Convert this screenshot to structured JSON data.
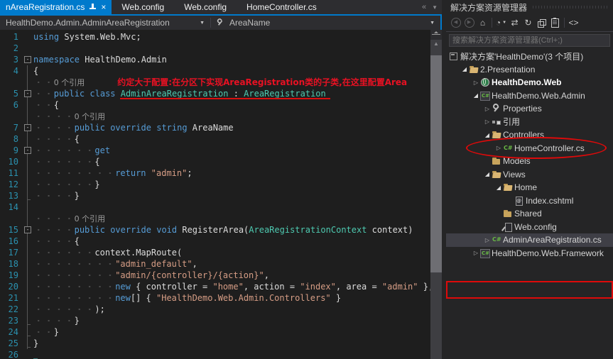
{
  "colors": {
    "accent": "#007ACC",
    "keyword": "#569CD6",
    "type": "#4EC9B0",
    "string": "#D69D85",
    "line_number": "#2B91AF",
    "annotation_red": "#DE0A0A",
    "editor_bg": "#1E1E1E",
    "panel_bg": "#252526"
  },
  "tabs": {
    "items": [
      {
        "label": "nAreaRegistration.cs",
        "active": true
      },
      {
        "label": "Web.config",
        "active": false
      },
      {
        "label": "Web.config",
        "active": false
      },
      {
        "label": "HomeController.cs",
        "active": false
      }
    ],
    "overflow_left": "«",
    "overflow_menu": "▼"
  },
  "navbar": {
    "type_path": "HealthDemo.Admin.AdminAreaRegistration",
    "member": "AreaName",
    "dropdown_glyph": "▼"
  },
  "editor": {
    "codelens_label": "0 个引用",
    "annotation_text": "约定大于配置:在分区下实现AreaRegistration类的子类,在这里配置Area",
    "lines": [
      {
        "n": "1",
        "seg": [
          [
            "k",
            "using"
          ],
          [
            "p",
            " System.Web.Mvc;"
          ]
        ]
      },
      {
        "n": "2"
      },
      {
        "n": "3",
        "fold": 1,
        "seg": [
          [
            "k",
            "namespace"
          ],
          [
            "p",
            " HealthDemo.Admin"
          ]
        ]
      },
      {
        "n": "4",
        "g": 1,
        "seg": [
          [
            "p",
            "{"
          ]
        ]
      },
      {
        "lens": 1,
        "g": 1,
        "ind": 4,
        "red": 1
      },
      {
        "n": "5",
        "fold": 1,
        "g": 1,
        "ind": 4,
        "underline": 1,
        "seg": [
          [
            "k",
            "public"
          ],
          [
            "p",
            " "
          ],
          [
            "k",
            "class"
          ],
          [
            "p",
            " "
          ],
          [
            "t",
            "AdminAreaRegistration"
          ],
          [
            "p",
            " : "
          ],
          [
            "t",
            "AreaRegistration"
          ]
        ]
      },
      {
        "n": "6",
        "g": 1,
        "ind": 4,
        "seg": [
          [
            "p",
            "{"
          ]
        ]
      },
      {
        "lens": 1,
        "g": 1,
        "ind": 8
      },
      {
        "n": "7",
        "fold": 1,
        "g": 1,
        "ind": 8,
        "seg": [
          [
            "k",
            "public"
          ],
          [
            "p",
            " "
          ],
          [
            "k",
            "override"
          ],
          [
            "p",
            " "
          ],
          [
            "k",
            "string"
          ],
          [
            "p",
            " AreaName"
          ]
        ]
      },
      {
        "n": "8",
        "g": 1,
        "ind": 8,
        "seg": [
          [
            "p",
            "{"
          ]
        ]
      },
      {
        "n": "9",
        "fold": 1,
        "g": 1,
        "ind": 12,
        "seg": [
          [
            "k",
            "get"
          ]
        ]
      },
      {
        "n": "10",
        "g": 1,
        "ind": 12,
        "seg": [
          [
            "p",
            "{"
          ]
        ]
      },
      {
        "n": "11",
        "g": 1,
        "ind": 16,
        "seg": [
          [
            "k",
            "return"
          ],
          [
            "p",
            " "
          ],
          [
            "s",
            "\"admin\""
          ],
          [
            "p",
            ";"
          ]
        ]
      },
      {
        "n": "12",
        "g": 1,
        "ind": 12,
        "seg": [
          [
            "p",
            "}"
          ]
        ]
      },
      {
        "n": "13",
        "g": 1,
        "tick": 1,
        "ind": 8,
        "seg": [
          [
            "p",
            "}"
          ]
        ]
      },
      {
        "n": "14",
        "g": 1
      },
      {
        "lens": 1,
        "g": 1,
        "ind": 8
      },
      {
        "n": "15",
        "fold": 1,
        "g": 1,
        "ind": 8,
        "seg": [
          [
            "k",
            "public"
          ],
          [
            "p",
            " "
          ],
          [
            "k",
            "override"
          ],
          [
            "p",
            " "
          ],
          [
            "k",
            "void"
          ],
          [
            "p",
            " RegisterArea("
          ],
          [
            "t",
            "AreaRegistrationContext"
          ],
          [
            "p",
            " context)"
          ]
        ]
      },
      {
        "n": "16",
        "g": 1,
        "ind": 8,
        "seg": [
          [
            "p",
            "{"
          ]
        ]
      },
      {
        "n": "17",
        "g": 1,
        "ind": 12,
        "seg": [
          [
            "p",
            "context.MapRoute("
          ]
        ]
      },
      {
        "n": "18",
        "g": 1,
        "ind": 16,
        "seg": [
          [
            "s",
            "\"admin_default\""
          ],
          [
            "p",
            ","
          ]
        ]
      },
      {
        "n": "19",
        "g": 1,
        "ind": 16,
        "seg": [
          [
            "s",
            "\"admin/{controller}/{action}\""
          ],
          [
            "p",
            ","
          ]
        ]
      },
      {
        "n": "20",
        "g": 1,
        "ind": 16,
        "seg": [
          [
            "k",
            "new"
          ],
          [
            "p",
            " { controller = "
          ],
          [
            "s",
            "\"home\""
          ],
          [
            "p",
            ", action = "
          ],
          [
            "s",
            "\"index\""
          ],
          [
            "p",
            ", area = "
          ],
          [
            "s",
            "\"admin\""
          ],
          [
            "p",
            " },"
          ]
        ]
      },
      {
        "n": "21",
        "g": 1,
        "ind": 16,
        "seg": [
          [
            "k",
            "new"
          ],
          [
            "p",
            "[] { "
          ],
          [
            "s",
            "\"HealthDemo.Web.Admin.Controllers\""
          ],
          [
            "p",
            " }"
          ]
        ]
      },
      {
        "n": "22",
        "g": 1,
        "ind": 12,
        "seg": [
          [
            "p",
            ");"
          ]
        ]
      },
      {
        "n": "23",
        "g": 1,
        "tick": 1,
        "ind": 8,
        "seg": [
          [
            "p",
            "}"
          ]
        ]
      },
      {
        "n": "24",
        "g": 1,
        "tick": 1,
        "ind": 4,
        "seg": [
          [
            "p",
            "}"
          ]
        ]
      },
      {
        "n": "25",
        "g": 1,
        "tick": 1,
        "seg": [
          [
            "p",
            "}"
          ]
        ]
      },
      {
        "n": "26",
        "caret": 1
      }
    ]
  },
  "explorer": {
    "title": "解决方案资源管理器",
    "search_placeholder": "搜索解决方案资源管理器(Ctrl+;)",
    "toolbar": [
      {
        "name": "back",
        "shape": "circle",
        "glyph": "◀",
        "dim": true
      },
      {
        "name": "forward",
        "shape": "circle",
        "glyph": "▶",
        "dim": true
      },
      {
        "name": "home",
        "glyph": "⌂"
      },
      {
        "sep": true
      },
      {
        "name": "pending-changes-filter",
        "glyph": "◔",
        "dropdown": true
      },
      {
        "name": "sync-with-active-document",
        "glyph": "⇄"
      },
      {
        "name": "refresh",
        "glyph": "↻"
      },
      {
        "name": "collapse-all",
        "shape": "pages"
      },
      {
        "name": "show-all-files",
        "shape": "clipboard"
      },
      {
        "sep": true
      },
      {
        "name": "view-code",
        "glyph": "<>"
      }
    ],
    "tree": [
      {
        "label": "解决方案'HealthDemo'(3 个项目)",
        "level": 0,
        "icon": "solution"
      },
      {
        "label": "2.Presentation",
        "level": 1,
        "arrow": "open",
        "icon": "folder-open"
      },
      {
        "label": "HealthDemo.Web",
        "level": 2,
        "arrow": "closed",
        "icon": "web-project",
        "bold": true
      },
      {
        "label": "HealthDemo.Web.Admin",
        "level": 2,
        "arrow": "open",
        "icon": "csharp-project",
        "circled": true
      },
      {
        "label": "Properties",
        "level": 3,
        "arrow": "closed",
        "icon": "wrench"
      },
      {
        "label": "引用",
        "level": 3,
        "arrow": "closed",
        "icon": "references"
      },
      {
        "label": "Controllers",
        "level": 3,
        "arrow": "open",
        "icon": "folder-open"
      },
      {
        "label": "HomeController.cs",
        "level": 4,
        "arrow": "closed",
        "icon": "csharp-file"
      },
      {
        "label": "Models",
        "level": 3,
        "icon": "folder"
      },
      {
        "label": "Views",
        "level": 3,
        "arrow": "open",
        "icon": "folder-open"
      },
      {
        "label": "Home",
        "level": 4,
        "arrow": "open",
        "icon": "folder-open"
      },
      {
        "label": "Index.cshtml",
        "level": 5,
        "icon": "cshtml-file"
      },
      {
        "label": "Shared",
        "level": 4,
        "icon": "folder"
      },
      {
        "label": "Web.config",
        "level": 4,
        "icon": "config-file"
      },
      {
        "label": "AdminAreaRegistration.cs",
        "level": 3,
        "arrow": "closed",
        "icon": "csharp-file",
        "selected": true,
        "boxed": true
      },
      {
        "label": "HealthDemo.Web.Framework",
        "level": 2,
        "arrow": "closed",
        "icon": "csharp-project"
      }
    ]
  }
}
